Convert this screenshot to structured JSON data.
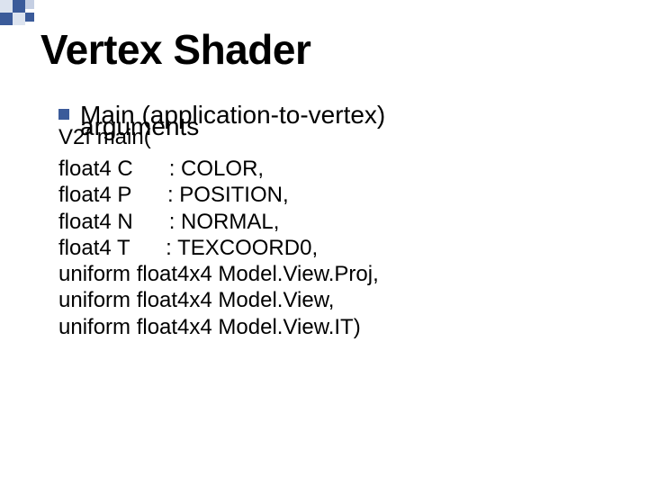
{
  "title": "Vertex Shader",
  "bullet_heading": "Main (application-to-vertex)",
  "overlap": {
    "arguments_word": "arguments",
    "v2f_word": "V2f main("
  },
  "code_lines": [
    "float4 C      : COLOR,",
    "float4 P      : POSITION,",
    "float4 N      : NORMAL,",
    "float4 T      : TEXCOORD0,",
    "uniform float4x4 Model.View.Proj,",
    "uniform float4x4 Model.View,",
    "uniform float4x4 Model.View.IT)"
  ]
}
